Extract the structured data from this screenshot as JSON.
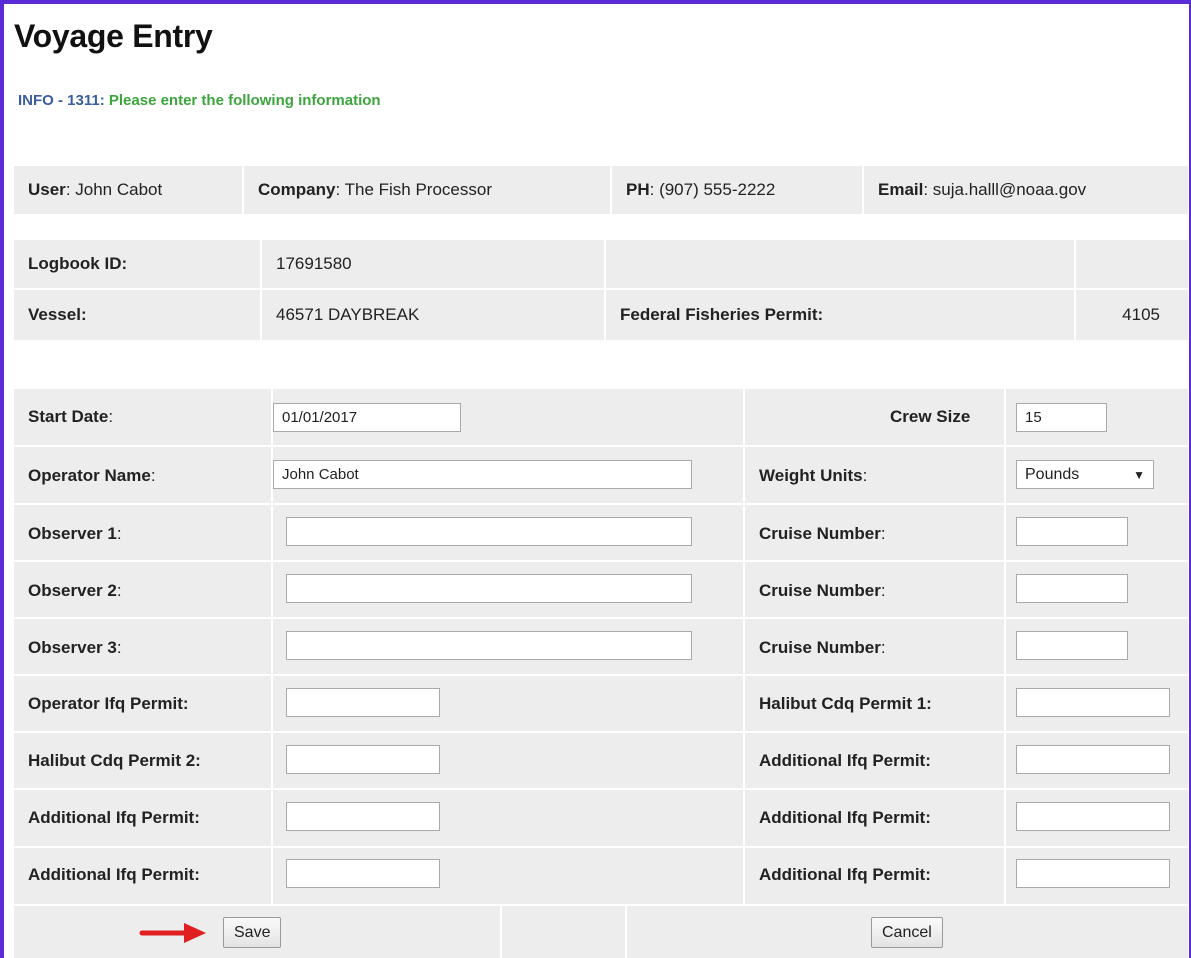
{
  "page": {
    "title": "Voyage Entry"
  },
  "info": {
    "code": "INFO - 1311:",
    "message": "Please enter the following information"
  },
  "user_bar": {
    "user_label": "User",
    "user_value": ": John Cabot",
    "company_label": "Company",
    "company_value": ": The Fish Processor",
    "phone_label": "PH",
    "phone_value": ": (907) 555-2222",
    "email_label": "Email",
    "email_value": ": suja.halll@noaa.gov"
  },
  "logbook": {
    "logbook_label": "Logbook ID:",
    "logbook_value": "17691580",
    "vessel_label": "Vessel:",
    "vessel_value": "46571 DAYBREAK",
    "ffp_label": "Federal Fisheries Permit:",
    "ffp_value": "4105"
  },
  "form": {
    "start_date_label": "Start Date",
    "start_date_value": "01/01/2017",
    "crew_size_label": "Crew Size",
    "crew_size_value": "15",
    "operator_name_label": "Operator Name",
    "operator_name_value": "John Cabot",
    "weight_units_label": "Weight Units",
    "weight_units_value": "Pounds",
    "observer1_label": "Observer 1",
    "observer2_label": "Observer 2",
    "observer3_label": "Observer 3",
    "cruise_number_label": "Cruise Number",
    "operator_ifq_label": "Operator Ifq Permit:",
    "halibut_cdq1_label": "Halibut Cdq Permit 1:",
    "halibut_cdq2_label": "Halibut Cdq Permit 2:",
    "additional_ifq_label": "Additional Ifq Permit:",
    "colon": ":"
  },
  "actions": {
    "save_label": "Save",
    "cancel_label": "Cancel"
  },
  "colors": {
    "accent_border": "#5a2bd6",
    "info_code": "#3a5ea0",
    "info_message": "#3ca53c",
    "arrow": "#e02020"
  }
}
